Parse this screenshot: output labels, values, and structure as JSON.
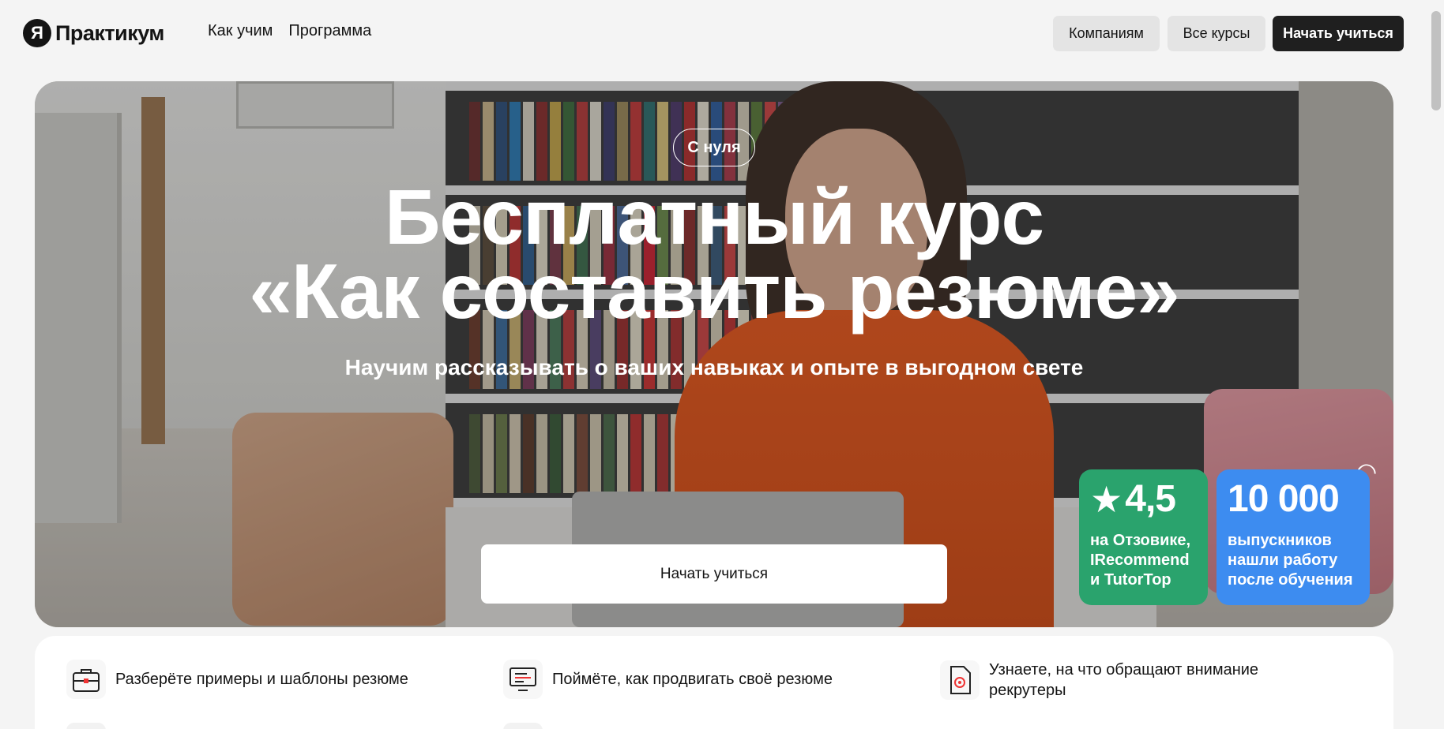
{
  "header": {
    "logo_mark": "Я",
    "logo_text": "Практикум",
    "nav": [
      "Как учим",
      "Программа"
    ],
    "btn_companies": "Компаниям",
    "btn_courses": "Все курсы",
    "btn_start": "Начать учиться"
  },
  "hero": {
    "tag": "С нуля",
    "title_line1": "Бесплатный курс",
    "title_line2": "«Как составить резюме»",
    "subtitle": "Научим рассказывать о ваших навыках и опыте в выгодном свете",
    "cta": "Начать учиться",
    "rating": {
      "value": "4,5",
      "text": "на Отзовике, IRecommend и TutorTop",
      "color": "#2aa36d"
    },
    "graduates": {
      "value": "10 000",
      "text": "выпускников нашли работу после обучения",
      "color": "#3d8cf0"
    }
  },
  "features": [
    {
      "icon": "briefcase-icon",
      "text": "Разберёте примеры и шаблоны резюме"
    },
    {
      "icon": "monitor-icon",
      "text": "Поймёте, как продвигать своё резюме"
    },
    {
      "icon": "document-icon",
      "text": "Узнаете, на что обращают внимание рекрутеры"
    }
  ]
}
